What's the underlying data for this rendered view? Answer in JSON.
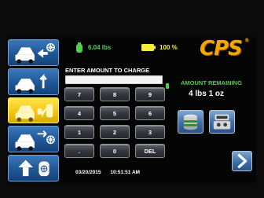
{
  "status": {
    "weight": "6.04 lbs",
    "battery": "100 %",
    "weight_icon": "tank-icon",
    "battery_icon": "battery-icon"
  },
  "logo": {
    "text": "CPS",
    "trademark": "®"
  },
  "sidebar": {
    "items": [
      {
        "icon": "recover-refrigerant-icon",
        "active": false
      },
      {
        "icon": "vacuum-icon",
        "active": false
      },
      {
        "icon": "charge-icon",
        "active": true
      },
      {
        "icon": "recycle-refrigerant-icon",
        "active": false
      },
      {
        "icon": "tank-fill-icon",
        "active": false
      }
    ]
  },
  "prompt": "ENTER AMOUNT TO CHARGE",
  "amount_input": {
    "value": "",
    "placeholder": ""
  },
  "keypad": {
    "keys": [
      "7",
      "8",
      "9",
      "4",
      "5",
      "6",
      "1",
      "2",
      "3",
      ".",
      "0",
      "DEL"
    ]
  },
  "amount_remaining": {
    "label": "AMOUNT REMAINING",
    "value": "4 lbs  1 oz"
  },
  "datetime": {
    "date": "03/20/2015",
    "time": "10:51:51 AM"
  },
  "actions": {
    "tank_icon": "refrigerant-tank-icon",
    "scale_icon": "scale-icon",
    "next_icon": "chevron-right-icon"
  },
  "colors": {
    "accent_blue": "#1f5796",
    "active_yellow": "#f3c30f",
    "status_green": "#4fd04a",
    "battery_yellow": "#f2ec3a",
    "logo_orange": "#f6a800"
  }
}
